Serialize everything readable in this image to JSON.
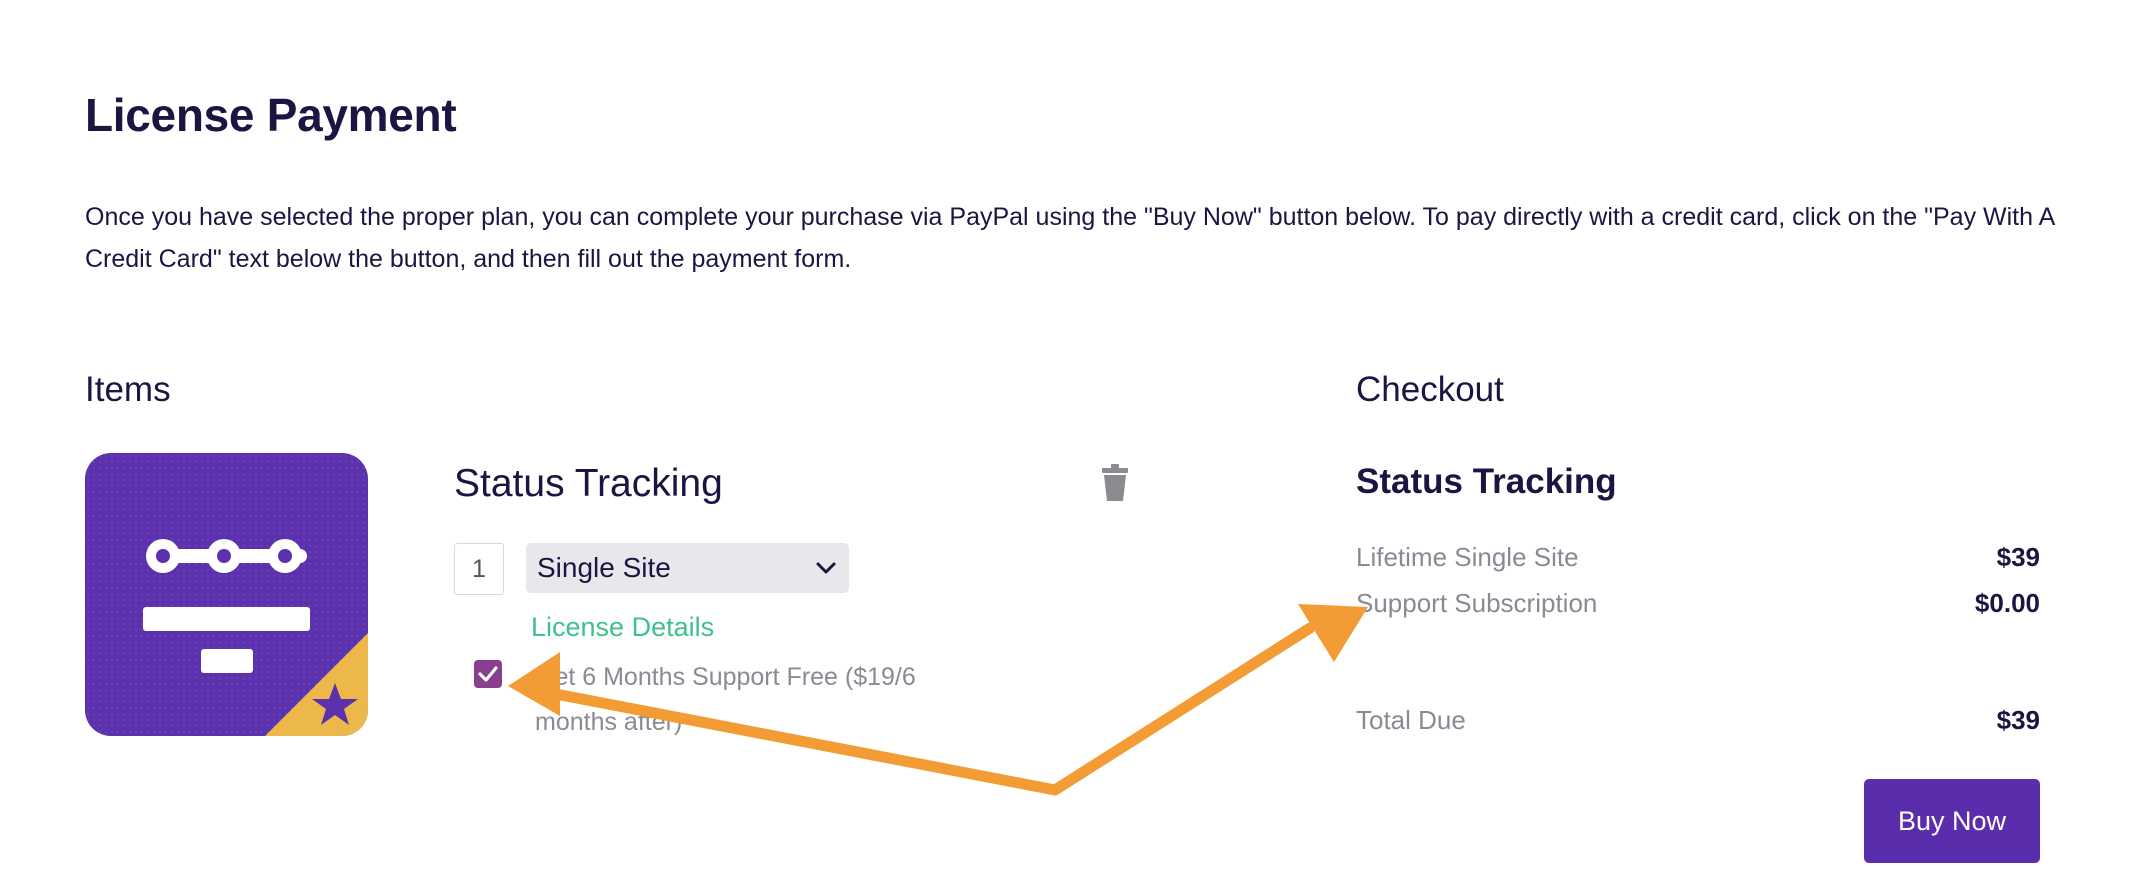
{
  "page": {
    "title": "License Payment",
    "intro": "Once you have selected the proper plan, you can complete your purchase via PayPal using the \"Buy Now\" button below. To pay directly with a credit card, click on the \"Pay With A Credit Card\" text below the button, and then fill out the payment form."
  },
  "items": {
    "heading": "Items",
    "product_icon": "status-tracking-product-icon",
    "name": "Status Tracking",
    "quantity": "1",
    "plan": "Single Site",
    "license_details_link": "License Details",
    "support_checkbox_checked": true,
    "support_label": "Get 6 Months Support Free ($19/6 months after)"
  },
  "checkout": {
    "heading": "Checkout",
    "item_name": "Status Tracking",
    "lines": [
      {
        "label": "Lifetime Single Site",
        "value": "$39"
      },
      {
        "label": "Support Subscription",
        "value": "$0.00"
      }
    ],
    "total_label": "Total Due",
    "total_value": "$39",
    "buy_button": "Buy Now"
  },
  "colors": {
    "text": "#1d1442",
    "muted": "#8a8a95",
    "accent": "#5a2dac",
    "link": "#3fc08d",
    "checkbox": "#873f8e",
    "annotation_arrow": "#f39c36"
  }
}
